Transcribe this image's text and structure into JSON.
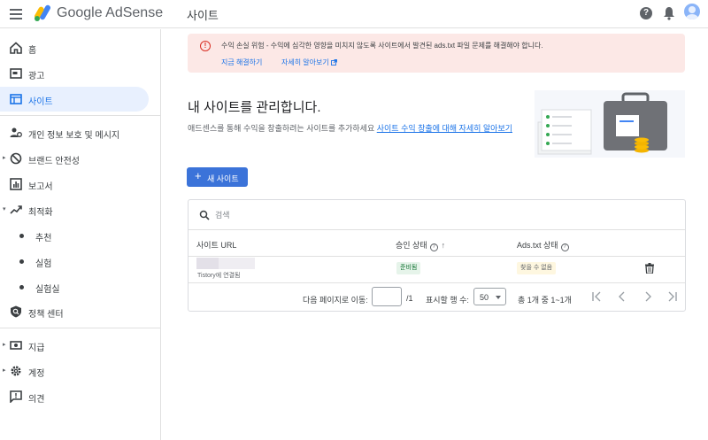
{
  "brand": {
    "name": "Google AdSense"
  },
  "header": {
    "page_title": "사이트",
    "help_glyph": "?"
  },
  "sidebar": {
    "items": [
      {
        "label": "홈",
        "icon": "home-icon"
      },
      {
        "label": "광고",
        "icon": "ads-icon"
      },
      {
        "label": "사이트",
        "icon": "sites-icon",
        "active": true
      },
      {
        "label": "개인 정보 보호 및 메시지",
        "icon": "privacy-icon"
      },
      {
        "label": "브랜드 안전성",
        "icon": "block-icon"
      },
      {
        "label": "보고서",
        "icon": "reports-icon"
      },
      {
        "label": "최적화",
        "icon": "optimize-icon"
      },
      {
        "label": "추천"
      },
      {
        "label": "실험"
      },
      {
        "label": "실험실"
      },
      {
        "label": "정책 센터",
        "icon": "policy-icon"
      },
      {
        "label": "지급",
        "icon": "payments-icon"
      },
      {
        "label": "계정",
        "icon": "gear-icon"
      },
      {
        "label": "의견",
        "icon": "feedback-icon"
      }
    ]
  },
  "alert": {
    "icon_glyph": "!",
    "message": "수익 손실 위험 - 수익에 심각한 영향을 미치지 않도록 사이트에서 발견된 ads.txt 파일 문제를 해결해야 합니다.",
    "fix_link": "지금 해결하기",
    "learn_link": "자세히 알아보기"
  },
  "main": {
    "title": "내 사이트를 관리합니다.",
    "desc": "애드센스를 통해 수익을 창출하려는 사이트를 추가하세요 ",
    "desc_link": "사이트 수익 창출에 대해 자세히 알아보기",
    "new_site": {
      "plus": "+",
      "label": "새 사이트"
    }
  },
  "table": {
    "search_placeholder": "검색",
    "columns": [
      "사이트 URL",
      "승인 상태",
      "Ads.txt 상태"
    ],
    "rows": [
      {
        "url_sub": "Tistory에 연결됨",
        "approval": "준비됨",
        "ads_txt": "찾을 수 없음"
      }
    ],
    "pager": {
      "goto_label": "다음 페이지로 이동:",
      "page_total": "/1",
      "rows_label": "표시할 행 수:",
      "rows_value": "50",
      "range": "총 1개 중 1~1개"
    }
  },
  "colors": {
    "accent": "#1a73e8",
    "button": "#3b73d9",
    "alert_bg": "#fce8e6",
    "alert_icon": "#d93025"
  }
}
